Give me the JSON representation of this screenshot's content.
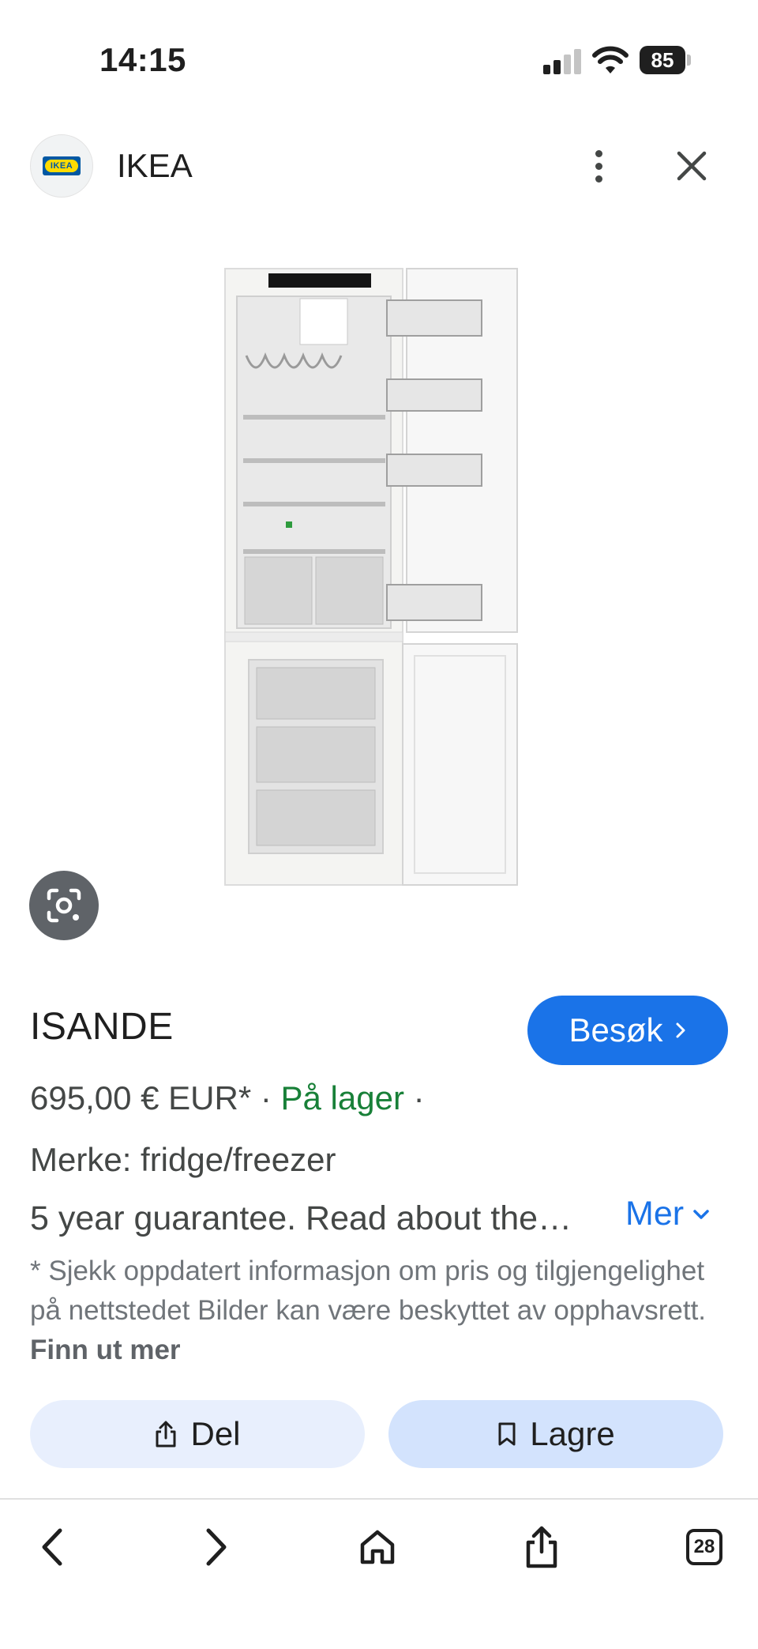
{
  "status_bar": {
    "time": "14:15",
    "battery": "85"
  },
  "header": {
    "logo_text": "IKEA",
    "site_name": "IKEA"
  },
  "product": {
    "title": "ISANDE",
    "visit_label": "Besøk",
    "price": "695,00 € EUR*",
    "separator": " · ",
    "stock": "På lager",
    "trailing_separator": " ·",
    "brand": "Merke: fridge/freezer",
    "description": "5 year guarantee. Read about the…",
    "more_label": "Mer",
    "disclaimer": "* Sjekk oppdatert informasjon om pris og tilgjengelighet på nettstedet Bilder kan være beskyttet av opphavsrett.",
    "learn_more": "Finn ut mer"
  },
  "actions": {
    "share_label": "Del",
    "save_label": "Lagre"
  },
  "toolbar": {
    "tabs_count": "28"
  },
  "colors": {
    "accent": "#1a73e8",
    "in_stock": "#188038",
    "ikea_blue": "#0058a3",
    "ikea_yellow": "#ffdb00"
  },
  "icons": [
    "signal-icon",
    "wifi-icon",
    "battery-icon",
    "more-vert-icon",
    "close-icon",
    "lens-icon",
    "chevron-right-icon",
    "chevron-down-icon",
    "share-icon",
    "bookmark-icon",
    "back-icon",
    "forward-icon",
    "home-icon",
    "share-toolbar-icon",
    "tabs-icon"
  ]
}
